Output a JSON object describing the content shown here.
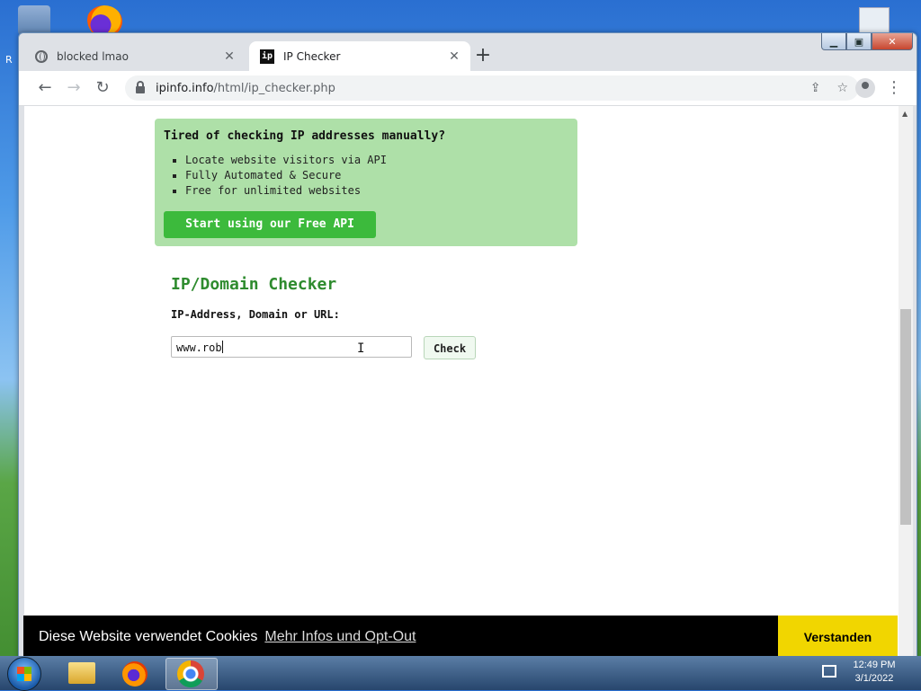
{
  "desktop": {
    "partial_label": "R"
  },
  "browser": {
    "tabs": [
      {
        "title": "blocked lmao",
        "icon": "globe-icon",
        "active": false
      },
      {
        "title": "IP Checker",
        "icon": "ipinfo-favicon",
        "favicon_text": "ip",
        "active": true
      }
    ],
    "new_tab_label": "+",
    "address": {
      "host": "ipinfo.info",
      "path": "/html/ip_checker.php"
    }
  },
  "page": {
    "promo": {
      "title": "Tired of checking IP addresses manually?",
      "bullets": [
        "Locate website visitors via API",
        "Fully Automated & Secure",
        "Free for unlimited websites"
      ],
      "button_label": "Start using our Free API"
    },
    "checker": {
      "title": "IP/Domain Checker",
      "label": "IP-Address, Domain or URL:",
      "input_value": "www.rob",
      "button_label": "Check"
    }
  },
  "cookie_banner": {
    "text": "Diese Website verwendet Cookies",
    "link": "Mehr Infos und Opt-Out",
    "button_label": "Verstanden"
  },
  "taskbar": {
    "clock_time": "12:49 PM",
    "clock_date": "3/1/2022"
  },
  "colors": {
    "promo_bg": "#aee0a8",
    "promo_button": "#3cba3c",
    "checker_title": "#2e8b2e",
    "cookie_button": "#f1d600"
  }
}
